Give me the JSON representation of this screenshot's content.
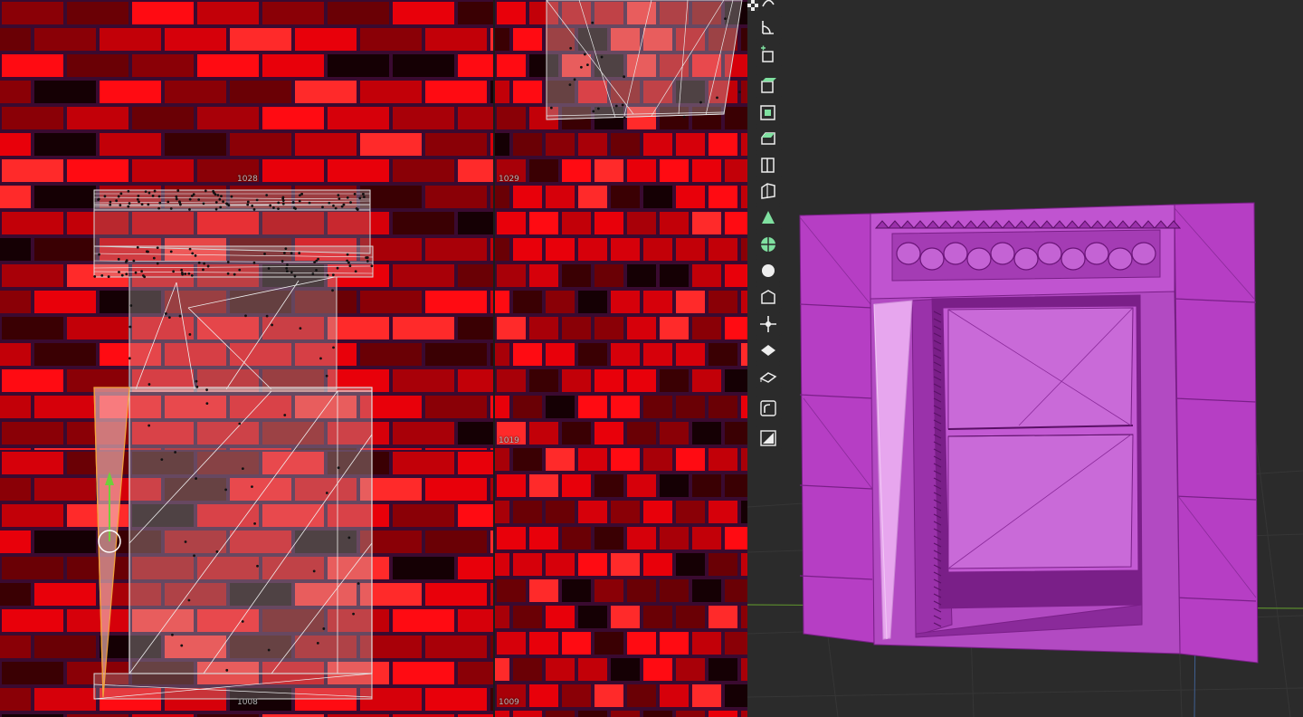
{
  "uv_editor": {
    "tiles": [
      {
        "id": "tile-1028",
        "label": "1028"
      },
      {
        "id": "tile-1029",
        "label": "1029"
      },
      {
        "id": "tile-1019",
        "label": "1019"
      },
      {
        "id": "tile-1008",
        "label": "1008"
      },
      {
        "id": "tile-1009",
        "label": "1009"
      }
    ]
  },
  "viewport": {
    "object_color": "#b63ec4",
    "toolbar": [
      {
        "name": "curve-tool-icon"
      },
      {
        "name": "measure-tool-icon"
      },
      {
        "name": "add-cube-tool-icon"
      },
      {
        "name": "extrude-region-tool-icon"
      },
      {
        "name": "inset-faces-tool-icon"
      },
      {
        "name": "bevel-tool-icon"
      },
      {
        "name": "loop-cut-tool-icon"
      },
      {
        "name": "knife-tool-icon"
      },
      {
        "name": "poly-build-tool-icon"
      },
      {
        "name": "spin-tool-icon"
      },
      {
        "name": "smooth-tool-icon"
      },
      {
        "name": "edge-slide-tool-icon"
      },
      {
        "name": "shrink-fatten-tool-icon"
      },
      {
        "name": "shear-tool-icon"
      },
      {
        "name": "rip-region-tool-icon"
      },
      {
        "name": "transform-tool-icon"
      },
      {
        "name": "rotate-tool-icon"
      }
    ]
  }
}
